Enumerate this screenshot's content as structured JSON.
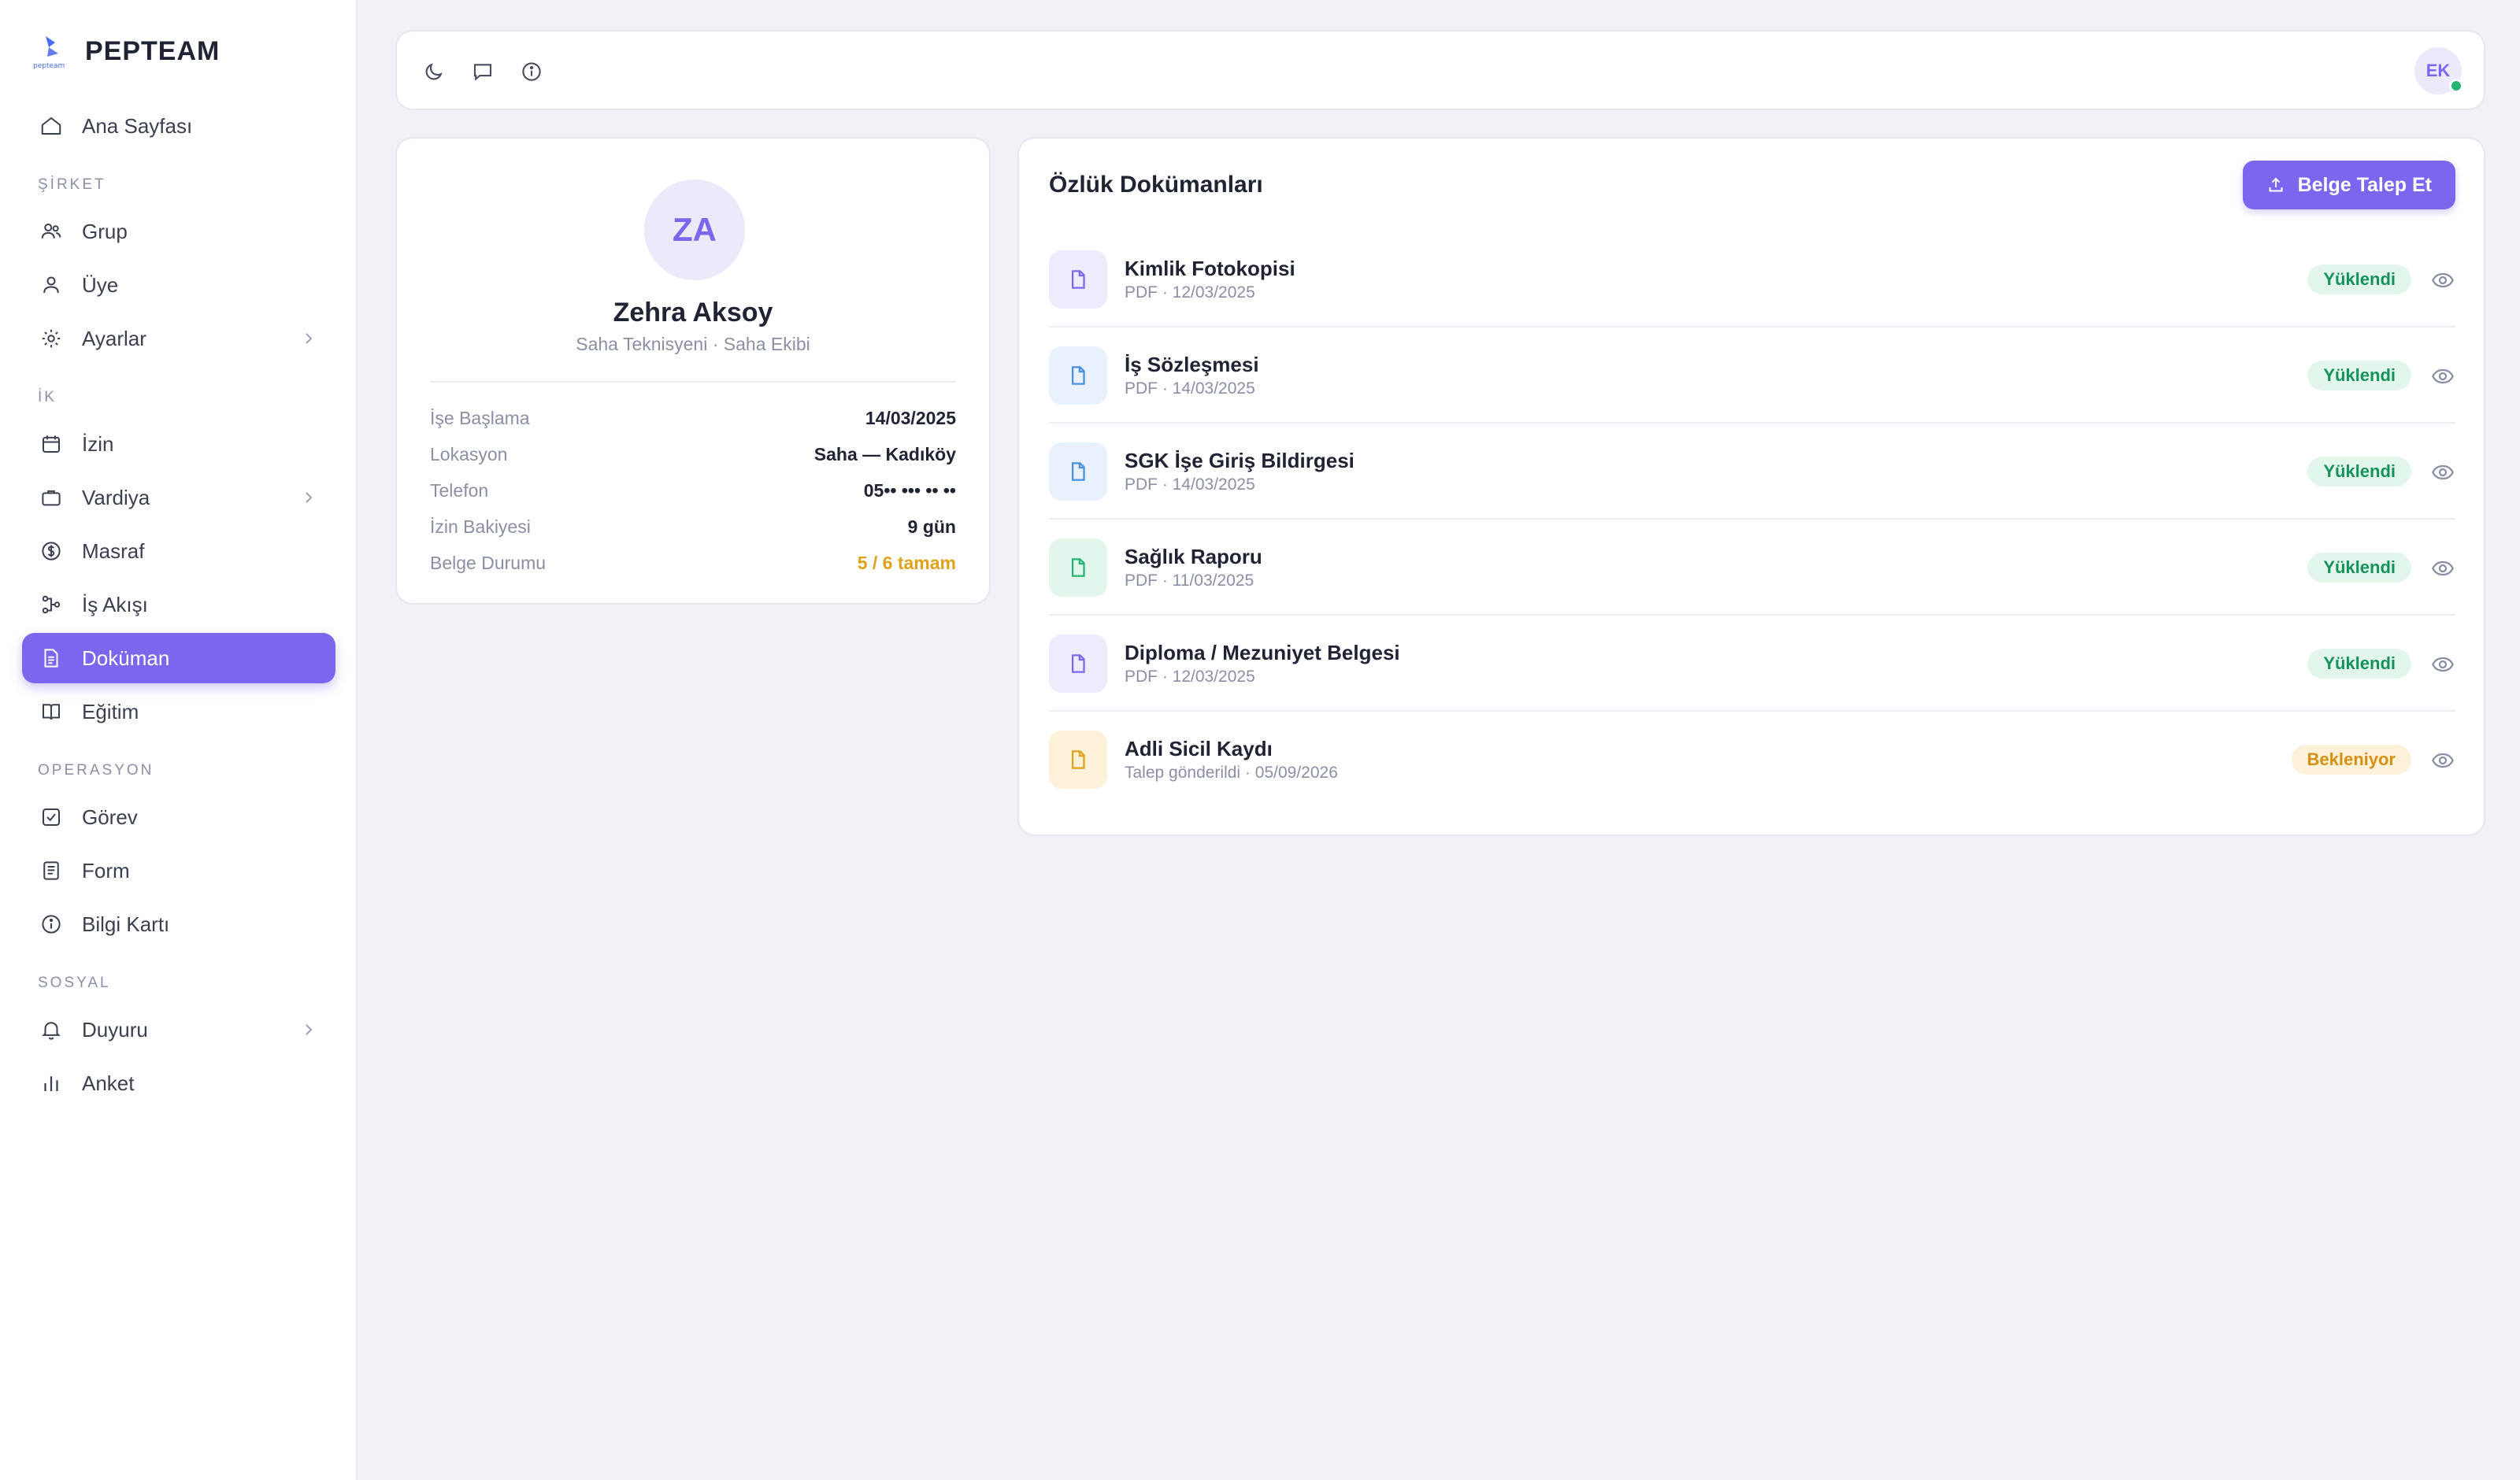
{
  "app": {
    "brand": "PEPTEAM",
    "brand_logo_text": "pepteam"
  },
  "sidebar": {
    "home": "Ana Sayfası",
    "sections": {
      "company": "ŞİRKET",
      "hr": "İK",
      "operations": "OPERASYON",
      "social": "SOSYAL"
    },
    "items": {
      "group": "Grup",
      "member": "Üye",
      "settings": "Ayarlar",
      "leave": "İzin",
      "shift": "Vardiya",
      "expense": "Masraf",
      "workflow": "İş Akışı",
      "document": "Doküman",
      "training": "Eğitim",
      "task": "Görev",
      "form": "Form",
      "info_card": "Bilgi Kartı",
      "announcement": "Duyuru",
      "survey": "Anket"
    },
    "active": "document"
  },
  "topbar": {
    "icons": [
      "moon-icon",
      "message-icon",
      "info-icon"
    ],
    "user_initials": "EK",
    "status_color": "#22b573"
  },
  "profile": {
    "initials": "ZA",
    "name": "Zehra Aksoy",
    "role": "Saha Teknisyeni · Saha Ekibi",
    "rows": [
      {
        "label": "İşe Başlama",
        "value": "14/03/2025"
      },
      {
        "label": "Lokasyon",
        "value": "Saha — Kadıköy"
      },
      {
        "label": "Telefon",
        "value": "05•• ••• •• ••"
      },
      {
        "label": "İzin Bakiyesi",
        "value": "9 gün"
      },
      {
        "label": "Belge Durumu",
        "value": "5 / 6 tamam"
      }
    ]
  },
  "documents": {
    "title": "Özlük Dokümanları",
    "request_button": "Belge Talep Et",
    "items": [
      {
        "name": "Kimlik Fotokopisi",
        "meta": "PDF · 12/03/2025",
        "status": "Yüklendi",
        "icon_color": "#7a67ee",
        "icon_bg": "#eeebfd"
      },
      {
        "name": "İş Sözleşmesi",
        "meta": "PDF · 14/03/2025",
        "status": "Yüklendi",
        "icon_color": "#4a90e2",
        "icon_bg": "#e8f1fc"
      },
      {
        "name": "SGK İşe Giriş Bildirgesi",
        "meta": "PDF · 14/03/2025",
        "status": "Yüklendi",
        "icon_color": "#4a90e2",
        "icon_bg": "#e8f1fc"
      },
      {
        "name": "Sağlık Raporu",
        "meta": "PDF · 11/03/2025",
        "status": "Yüklendi",
        "icon_color": "#22b573",
        "icon_bg": "#e3f6ec"
      },
      {
        "name": "Diploma / Mezuniyet Belgesi",
        "meta": "PDF · 12/03/2025",
        "status": "Yüklendi",
        "icon_color": "#7a67ee",
        "icon_bg": "#eeebfd"
      },
      {
        "name": "Adli Sicil Kaydı",
        "meta": "Talep gönderildi · 05/09/2026",
        "status": "Bekleniyor",
        "icon_color": "#e0a21b",
        "icon_bg": "#fdf1da"
      }
    ]
  },
  "colors": {
    "accent": "#7a67ee",
    "success": "#16935a",
    "warning": "#d6900f"
  }
}
